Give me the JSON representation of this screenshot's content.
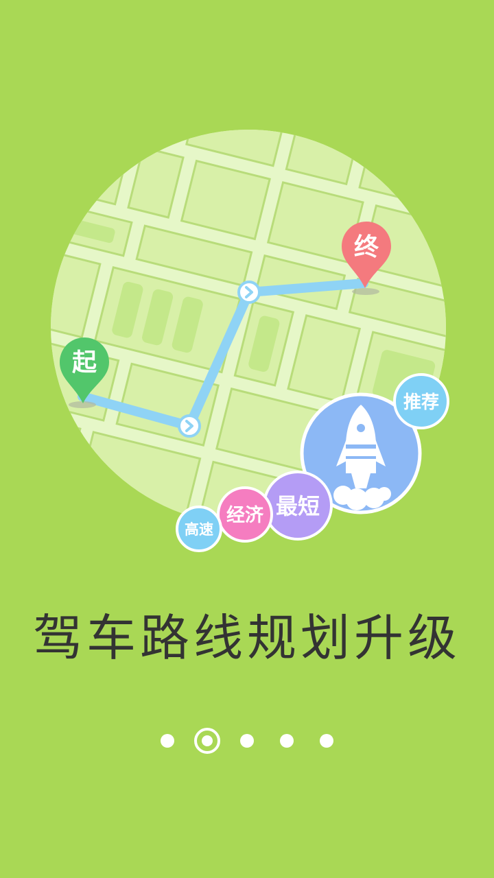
{
  "map": {
    "start_pin_label": "起",
    "end_pin_label": "终",
    "route_options": [
      {
        "label": "推荐",
        "color": "#7fd0f5"
      },
      {
        "label": "最短",
        "color": "#b49cf5"
      },
      {
        "label": "经济",
        "color": "#f57dc0"
      },
      {
        "label": "高速",
        "color": "#7fd0f5"
      }
    ],
    "featured_icon": "rocket-icon",
    "colors": {
      "map_background": "#e6f7c8",
      "block": "#d8f0a8",
      "route": "#8fd3f5",
      "start_pin": "#52c66b",
      "end_pin": "#f47a7e",
      "featured_circle": "#8cb8f5"
    }
  },
  "headline": "驾车路线规划升级",
  "pager": {
    "total": 5,
    "active_index": 1
  },
  "colors": {
    "background": "#a9d855",
    "headline_text": "#333333"
  }
}
